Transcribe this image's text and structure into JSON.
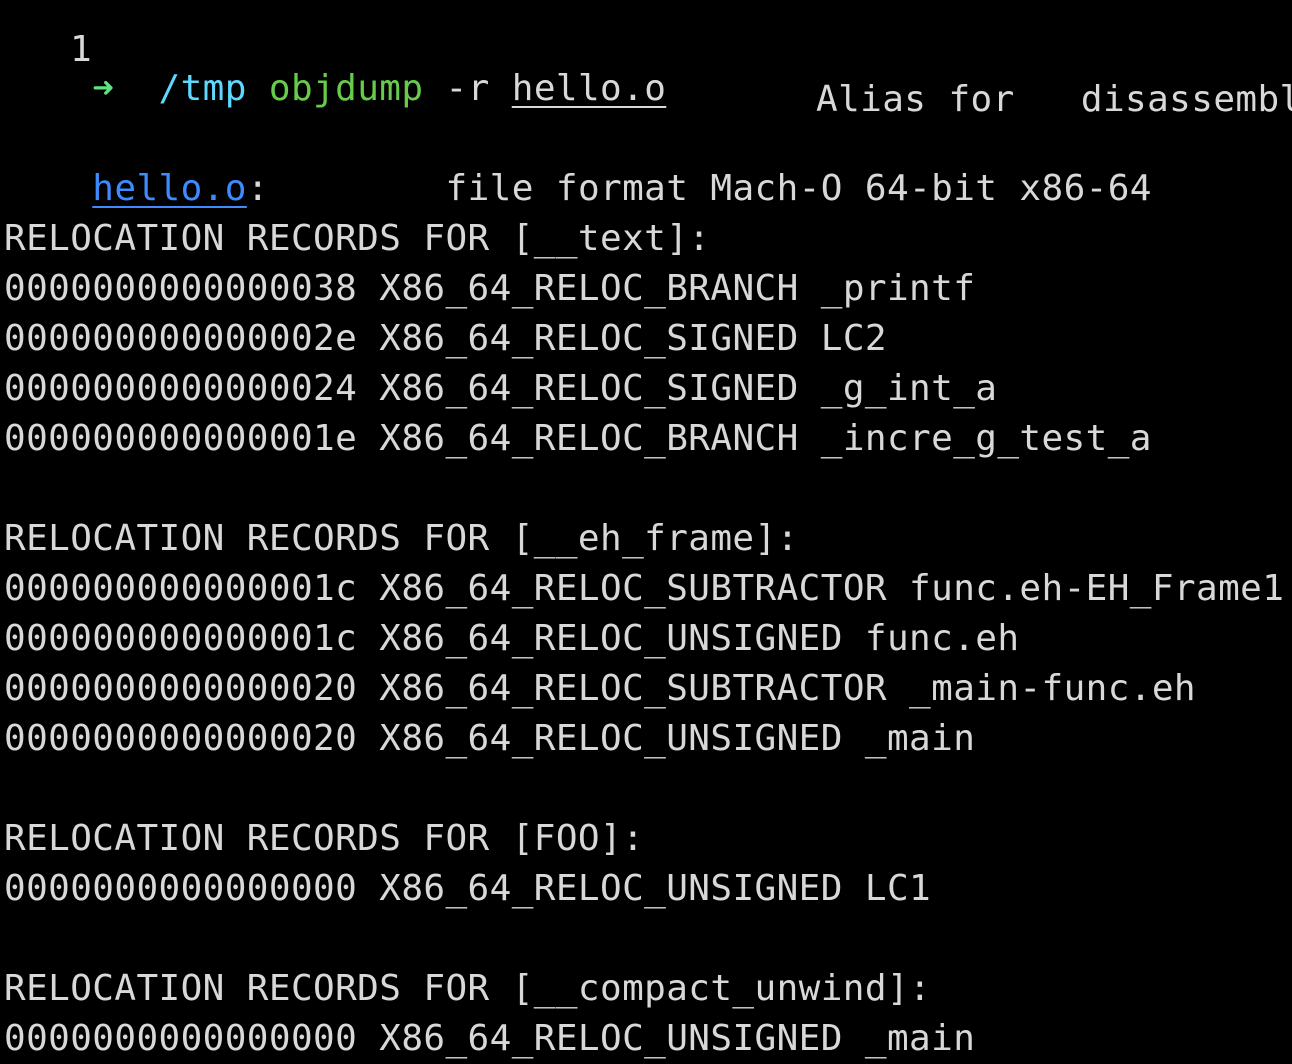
{
  "partial_top": {
    "left": "1",
    "right": "Alias for   disassembl"
  },
  "prompt": {
    "arrow": "➜",
    "cwd": "/tmp",
    "command": "objdump",
    "flag": "-r",
    "file": "hello.o"
  },
  "header": {
    "file": "hello.o",
    "colon": ":",
    "format": "file format Mach-O 64-bit x86-64"
  },
  "sections": [
    {
      "title": "RELOCATION RECORDS FOR [__text]:",
      "records": [
        {
          "offset": "0000000000000038",
          "type": "X86_64_RELOC_BRANCH",
          "symbol": "_printf"
        },
        {
          "offset": "000000000000002e",
          "type": "X86_64_RELOC_SIGNED",
          "symbol": "LC2"
        },
        {
          "offset": "0000000000000024",
          "type": "X86_64_RELOC_SIGNED",
          "symbol": "_g_int_a"
        },
        {
          "offset": "000000000000001e",
          "type": "X86_64_RELOC_BRANCH",
          "symbol": "_incre_g_test_a"
        }
      ]
    },
    {
      "title": "RELOCATION RECORDS FOR [__eh_frame]:",
      "records": [
        {
          "offset": "000000000000001c",
          "type": "X86_64_RELOC_SUBTRACTOR",
          "symbol": "func.eh-EH_Frame1"
        },
        {
          "offset": "000000000000001c",
          "type": "X86_64_RELOC_UNSIGNED",
          "symbol": "func.eh"
        },
        {
          "offset": "0000000000000020",
          "type": "X86_64_RELOC_SUBTRACTOR",
          "symbol": "_main-func.eh"
        },
        {
          "offset": "0000000000000020",
          "type": "X86_64_RELOC_UNSIGNED",
          "symbol": "_main"
        }
      ]
    },
    {
      "title": "RELOCATION RECORDS FOR [FOO]:",
      "records": [
        {
          "offset": "0000000000000000",
          "type": "X86_64_RELOC_UNSIGNED",
          "symbol": "LC1"
        }
      ]
    },
    {
      "title": "RELOCATION RECORDS FOR [__compact_unwind]:",
      "records": [
        {
          "offset": "0000000000000000",
          "type": "X86_64_RELOC_UNSIGNED",
          "symbol": "_main"
        }
      ]
    }
  ],
  "colors": {
    "background": "#000000",
    "text": "#d8d8d8",
    "arrow": "#5ee37f",
    "cwd": "#5fd7ff",
    "command": "#66cc4a",
    "link": "#3d8bff"
  }
}
